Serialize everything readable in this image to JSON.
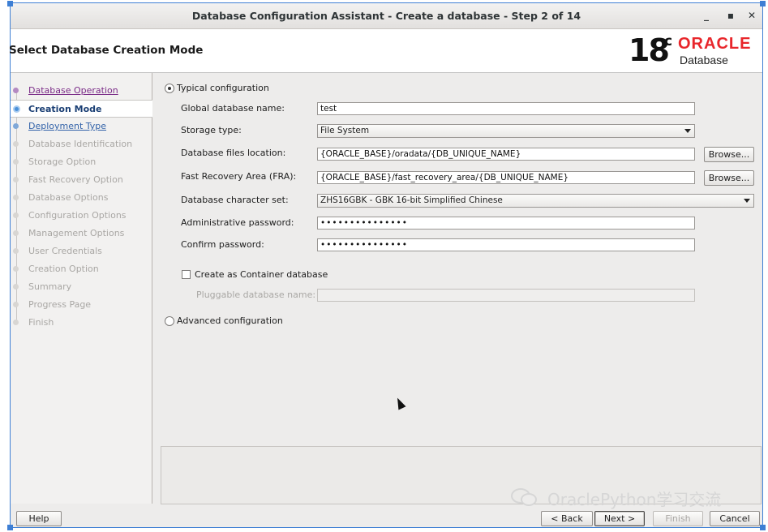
{
  "window": {
    "title": "Database Configuration Assistant - Create a database - Step 2 of 14",
    "minimize_glyph": "_",
    "maximize_glyph": "▪",
    "close_glyph": "✕"
  },
  "header": {
    "page_title": "Select Database Creation Mode",
    "logo_version": "18",
    "logo_suffix": "c",
    "logo_brand": "ORACLE",
    "logo_product": "Database",
    "brand_color": "#e8262b"
  },
  "nav": {
    "items": [
      {
        "label": "Database Operation",
        "state": "done"
      },
      {
        "label": "Creation Mode",
        "state": "current"
      },
      {
        "label": "Deployment Type",
        "state": "link"
      },
      {
        "label": "Database Identification",
        "state": "disabled"
      },
      {
        "label": "Storage Option",
        "state": "disabled"
      },
      {
        "label": "Fast Recovery Option",
        "state": "disabled"
      },
      {
        "label": "Database Options",
        "state": "disabled"
      },
      {
        "label": "Configuration Options",
        "state": "disabled"
      },
      {
        "label": "Management Options",
        "state": "disabled"
      },
      {
        "label": "User Credentials",
        "state": "disabled"
      },
      {
        "label": "Creation Option",
        "state": "disabled"
      },
      {
        "label": "Summary",
        "state": "disabled"
      },
      {
        "label": "Progress Page",
        "state": "disabled"
      },
      {
        "label": "Finish",
        "state": "disabled"
      }
    ]
  },
  "form": {
    "typical_label": "Typical configuration",
    "typical_selected": true,
    "global_db_name_label": "Global database name:",
    "global_db_name_value": "test",
    "storage_type_label": "Storage type:",
    "storage_type_value": "File System",
    "db_files_location_label": "Database files location:",
    "db_files_location_value": "{ORACLE_BASE}/oradata/{DB_UNIQUE_NAME}",
    "fra_label": "Fast Recovery Area (FRA):",
    "fra_value": "{ORACLE_BASE}/fast_recovery_area/{DB_UNIQUE_NAME}",
    "browse_label": "Browse...",
    "charset_label": "Database character set:",
    "charset_value": "ZHS16GBK - GBK 16-bit Simplified Chinese",
    "admin_password_label": "Administrative password:",
    "admin_password_value": "•••••••••••••••",
    "confirm_password_label": "Confirm password:",
    "confirm_password_value": "•••••••••••••••",
    "container_label": "Create as Container database",
    "container_checked": false,
    "pluggable_label": "Pluggable database name:",
    "pluggable_value": "",
    "advanced_label": "Advanced configuration",
    "advanced_selected": false
  },
  "footer": {
    "help_label": "Help",
    "back_label": "< Back",
    "next_label": "Next >",
    "finish_label": "Finish",
    "cancel_label": "Cancel"
  },
  "watermark": {
    "text": "OraclePython学习交流"
  }
}
